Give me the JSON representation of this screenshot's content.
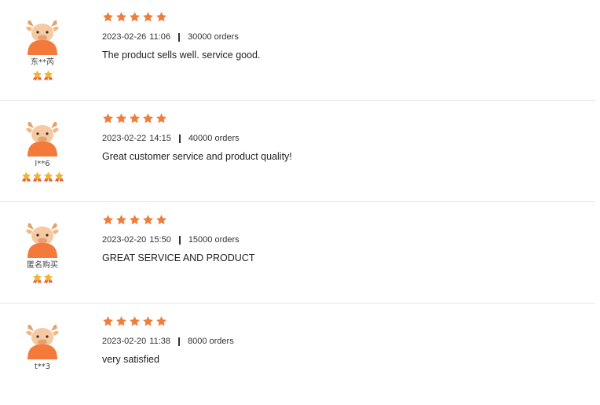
{
  "colors": {
    "star": "#ee7e3a",
    "avatar": "#f37a3a",
    "divider": "#e6e6e6"
  },
  "reviews": [
    {
      "user": "东**芮",
      "badge_count": 2,
      "rating": 5,
      "date": "2023-02-26",
      "time": "11:06",
      "orders": "30000 orders",
      "comment": "The product sells well. service good."
    },
    {
      "user": "l**6",
      "badge_count": 4,
      "rating": 5,
      "date": "2023-02-22",
      "time": "14:15",
      "orders": "40000 orders",
      "comment": "Great customer service and product quality!"
    },
    {
      "user": "匿名购买",
      "badge_count": 2,
      "rating": 5,
      "date": "2023-02-20",
      "time": "15:50",
      "orders": "15000 orders",
      "comment": "GREAT SERVICE AND PRODUCT"
    },
    {
      "user": "t**3",
      "badge_count": 0,
      "rating": 5,
      "date": "2023-02-20",
      "time": "11:38",
      "orders": "8000 orders",
      "comment": "very satisfied"
    }
  ]
}
